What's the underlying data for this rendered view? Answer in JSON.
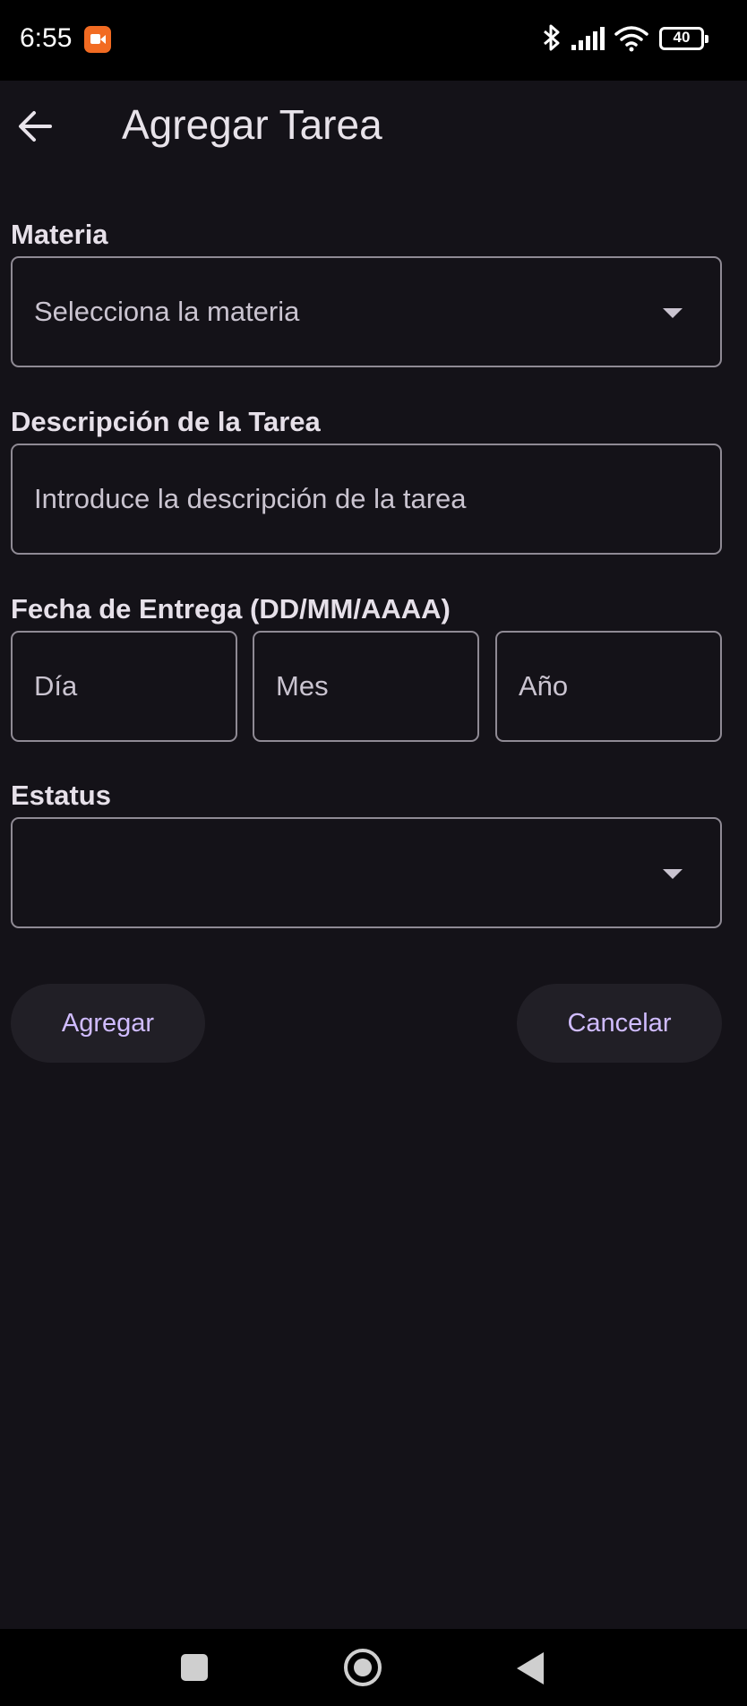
{
  "status_bar": {
    "time": "6:55",
    "battery": "40",
    "icons": [
      "screen-record-icon",
      "bluetooth-icon",
      "signal-icon",
      "wifi-icon",
      "battery-icon"
    ]
  },
  "app_bar": {
    "title": "Agregar Tarea",
    "back_icon": "arrow-back-icon"
  },
  "form": {
    "materia": {
      "label": "Materia",
      "placeholder": "Selecciona la materia",
      "icon": "dropdown-arrow-icon"
    },
    "descripcion": {
      "label": "Descripción de la Tarea",
      "placeholder": "Introduce la descripción de la tarea"
    },
    "fecha": {
      "label": "Fecha de Entrega (DD/MM/AAAA)",
      "dia_placeholder": "Día",
      "mes_placeholder": "Mes",
      "anio_placeholder": "Año"
    },
    "estatus": {
      "label": "Estatus",
      "value": "",
      "icon": "dropdown-arrow-icon"
    }
  },
  "actions": {
    "add_label": "Agregar",
    "cancel_label": "Cancelar"
  },
  "nav_bar": {
    "icons": [
      "recents-icon",
      "home-icon",
      "back-icon"
    ]
  },
  "colors": {
    "background": "#141218",
    "accent": "#d0bcff",
    "outline": "#8f8a94",
    "button_surface": "#211f26"
  }
}
